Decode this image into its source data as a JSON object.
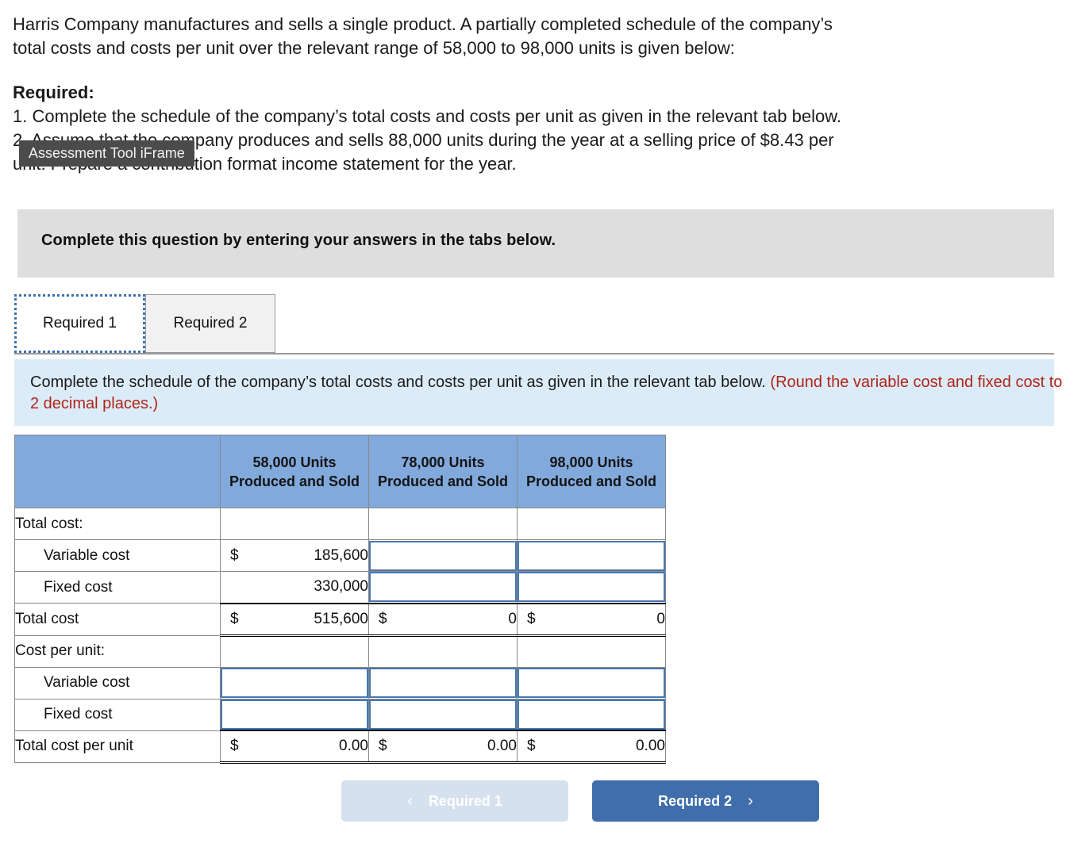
{
  "problem": {
    "intro_line1": "Harris Company manufactures and sells a single product. A partially completed schedule of the company’s",
    "intro_line2": "total costs and costs per unit over the relevant range of 58,000 to 98,000 units is given below:",
    "required_label": "Required:",
    "req1": "1. Complete the schedule of the company’s total costs and costs per unit as given in the relevant tab below.",
    "req2_line1": "2. Assume that the company produces and sells 88,000 units during the year at a selling price of $8.43 per",
    "req2_line2": "unit. Prepare a contribution format income statement for the year."
  },
  "tooltip": {
    "text": "Assessment Tool iFrame"
  },
  "gray_banner": {
    "text": "Complete this question by entering your answers in the tabs below."
  },
  "tabs": [
    {
      "label": "Required 1",
      "active": true
    },
    {
      "label": "Required 2",
      "active": false
    }
  ],
  "instruction": {
    "normal": "Complete the schedule of the company’s total costs and costs per unit as given in the relevant tab below. ",
    "red": "(Round the variable cost and fixed cost to 2 decimal places.)"
  },
  "table": {
    "headers": [
      "",
      "58,000 Units Produced and Sold",
      "78,000 Units Produced and Sold",
      "98,000 Units Produced and Sold"
    ],
    "rows": [
      {
        "label": "Total cost:",
        "indent": false,
        "kind": "section",
        "cells": [
          {
            "type": "empty"
          },
          {
            "type": "empty"
          },
          {
            "type": "empty"
          }
        ]
      },
      {
        "label": "Variable cost",
        "indent": true,
        "kind": "data",
        "cells": [
          {
            "type": "money",
            "symbol": "$",
            "value": "185,600"
          },
          {
            "type": "input",
            "value": ""
          },
          {
            "type": "input",
            "value": ""
          }
        ]
      },
      {
        "label": "Fixed cost",
        "indent": true,
        "kind": "data",
        "cells": [
          {
            "type": "number",
            "symbol": "",
            "value": "330,000"
          },
          {
            "type": "input",
            "value": ""
          },
          {
            "type": "input",
            "value": ""
          }
        ]
      },
      {
        "label": "Total cost",
        "indent": false,
        "kind": "total",
        "cells": [
          {
            "type": "money",
            "symbol": "$",
            "value": "515,600"
          },
          {
            "type": "money",
            "symbol": "$",
            "value": "0"
          },
          {
            "type": "money",
            "symbol": "$",
            "value": "0"
          }
        ]
      },
      {
        "label": "Cost per unit:",
        "indent": false,
        "kind": "section",
        "cells": [
          {
            "type": "empty"
          },
          {
            "type": "empty"
          },
          {
            "type": "empty"
          }
        ]
      },
      {
        "label": "Variable cost",
        "indent": true,
        "kind": "data",
        "cells": [
          {
            "type": "input",
            "value": ""
          },
          {
            "type": "input",
            "value": ""
          },
          {
            "type": "input",
            "value": ""
          }
        ]
      },
      {
        "label": "Fixed cost",
        "indent": true,
        "kind": "data",
        "cells": [
          {
            "type": "input",
            "value": ""
          },
          {
            "type": "input",
            "value": ""
          },
          {
            "type": "input",
            "value": ""
          }
        ]
      },
      {
        "label": "Total cost per unit",
        "indent": false,
        "kind": "total",
        "cells": [
          {
            "type": "money",
            "symbol": "$",
            "value": "0.00"
          },
          {
            "type": "money",
            "symbol": "$",
            "value": "0.00"
          },
          {
            "type": "money",
            "symbol": "$",
            "value": "0.00"
          }
        ]
      }
    ]
  },
  "footer": {
    "prev_label": "Required 1",
    "prev_chevron": "‹",
    "next_label": "Required 2",
    "next_chevron": "›"
  },
  "colors": {
    "table_header_blue": "#81a9dc",
    "instruction_blue": "#dcebf8",
    "banner_gray": "#dedede",
    "input_border_blue": "#4878b0",
    "next_button_blue": "#3f6eab",
    "prev_button_blue": "#d5e1ef",
    "red_note": "#b02418",
    "tooltip_gray": "#4b4b4b"
  }
}
